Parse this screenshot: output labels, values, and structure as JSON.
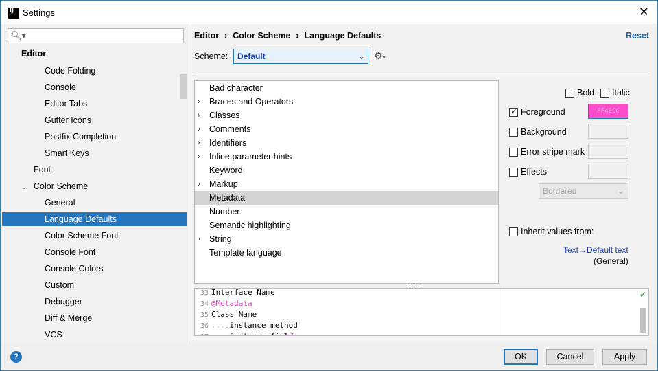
{
  "window": {
    "title": "Settings",
    "app_icon_text": "IJ"
  },
  "search": {
    "placeholder": "",
    "value": ""
  },
  "sidebar": {
    "items": [
      {
        "label": "Editor"
      },
      {
        "label": "Code Folding"
      },
      {
        "label": "Console"
      },
      {
        "label": "Editor Tabs"
      },
      {
        "label": "Gutter Icons"
      },
      {
        "label": "Postfix Completion"
      },
      {
        "label": "Smart Keys"
      },
      {
        "label": "Font"
      },
      {
        "label": "Color Scheme"
      },
      {
        "label": "General"
      },
      {
        "label": "Language Defaults"
      },
      {
        "label": "Color Scheme Font"
      },
      {
        "label": "Console Font"
      },
      {
        "label": "Console Colors"
      },
      {
        "label": "Custom"
      },
      {
        "label": "Debugger"
      },
      {
        "label": "Diff & Merge"
      },
      {
        "label": "VCS"
      }
    ]
  },
  "breadcrumb": {
    "part1": "Editor",
    "part2": "Color Scheme",
    "part3": "Language Defaults",
    "separator": "›"
  },
  "reset_label": "Reset",
  "scheme": {
    "label": "Scheme:",
    "value": "Default"
  },
  "attributes": {
    "items": [
      {
        "label": "Bad character",
        "expandable": false
      },
      {
        "label": "Braces and Operators",
        "expandable": true
      },
      {
        "label": "Classes",
        "expandable": true
      },
      {
        "label": "Comments",
        "expandable": true
      },
      {
        "label": "Identifiers",
        "expandable": true
      },
      {
        "label": "Inline parameter hints",
        "expandable": true
      },
      {
        "label": "Keyword",
        "expandable": false
      },
      {
        "label": "Markup",
        "expandable": true
      },
      {
        "label": "Metadata",
        "expandable": false
      },
      {
        "label": "Number",
        "expandable": false
      },
      {
        "label": "Semantic highlighting",
        "expandable": false
      },
      {
        "label": "String",
        "expandable": true
      },
      {
        "label": "Template language",
        "expandable": false
      }
    ],
    "selected": "Metadata"
  },
  "props": {
    "bold": "Bold",
    "italic": "Italic",
    "foreground": "Foreground",
    "foreground_color": "FF4ECC",
    "background": "Background",
    "error_stripe": "Error stripe mark",
    "effects": "Effects",
    "effects_type": "Bordered",
    "inherit": "Inherit values from:",
    "inherit_link": "Text→Default text",
    "inherit_sub": "(General)"
  },
  "preview": {
    "lines": [
      {
        "num": "33",
        "text": "Interface Name"
      },
      {
        "num": "34",
        "text": "@Metadata"
      },
      {
        "num": "35",
        "text": "Class Name"
      },
      {
        "num": "36",
        "dots": "....",
        "text": "instance method"
      },
      {
        "num": "37",
        "dots": "....",
        "text": "instance ",
        "field": "field"
      }
    ]
  },
  "buttons": {
    "ok": "OK",
    "cancel": "Cancel",
    "apply": "Apply",
    "help": "?"
  },
  "colors": {
    "accent": "#2675bf",
    "foreground_swatch": "#ff4ecc",
    "link": "#1b3fa8"
  }
}
